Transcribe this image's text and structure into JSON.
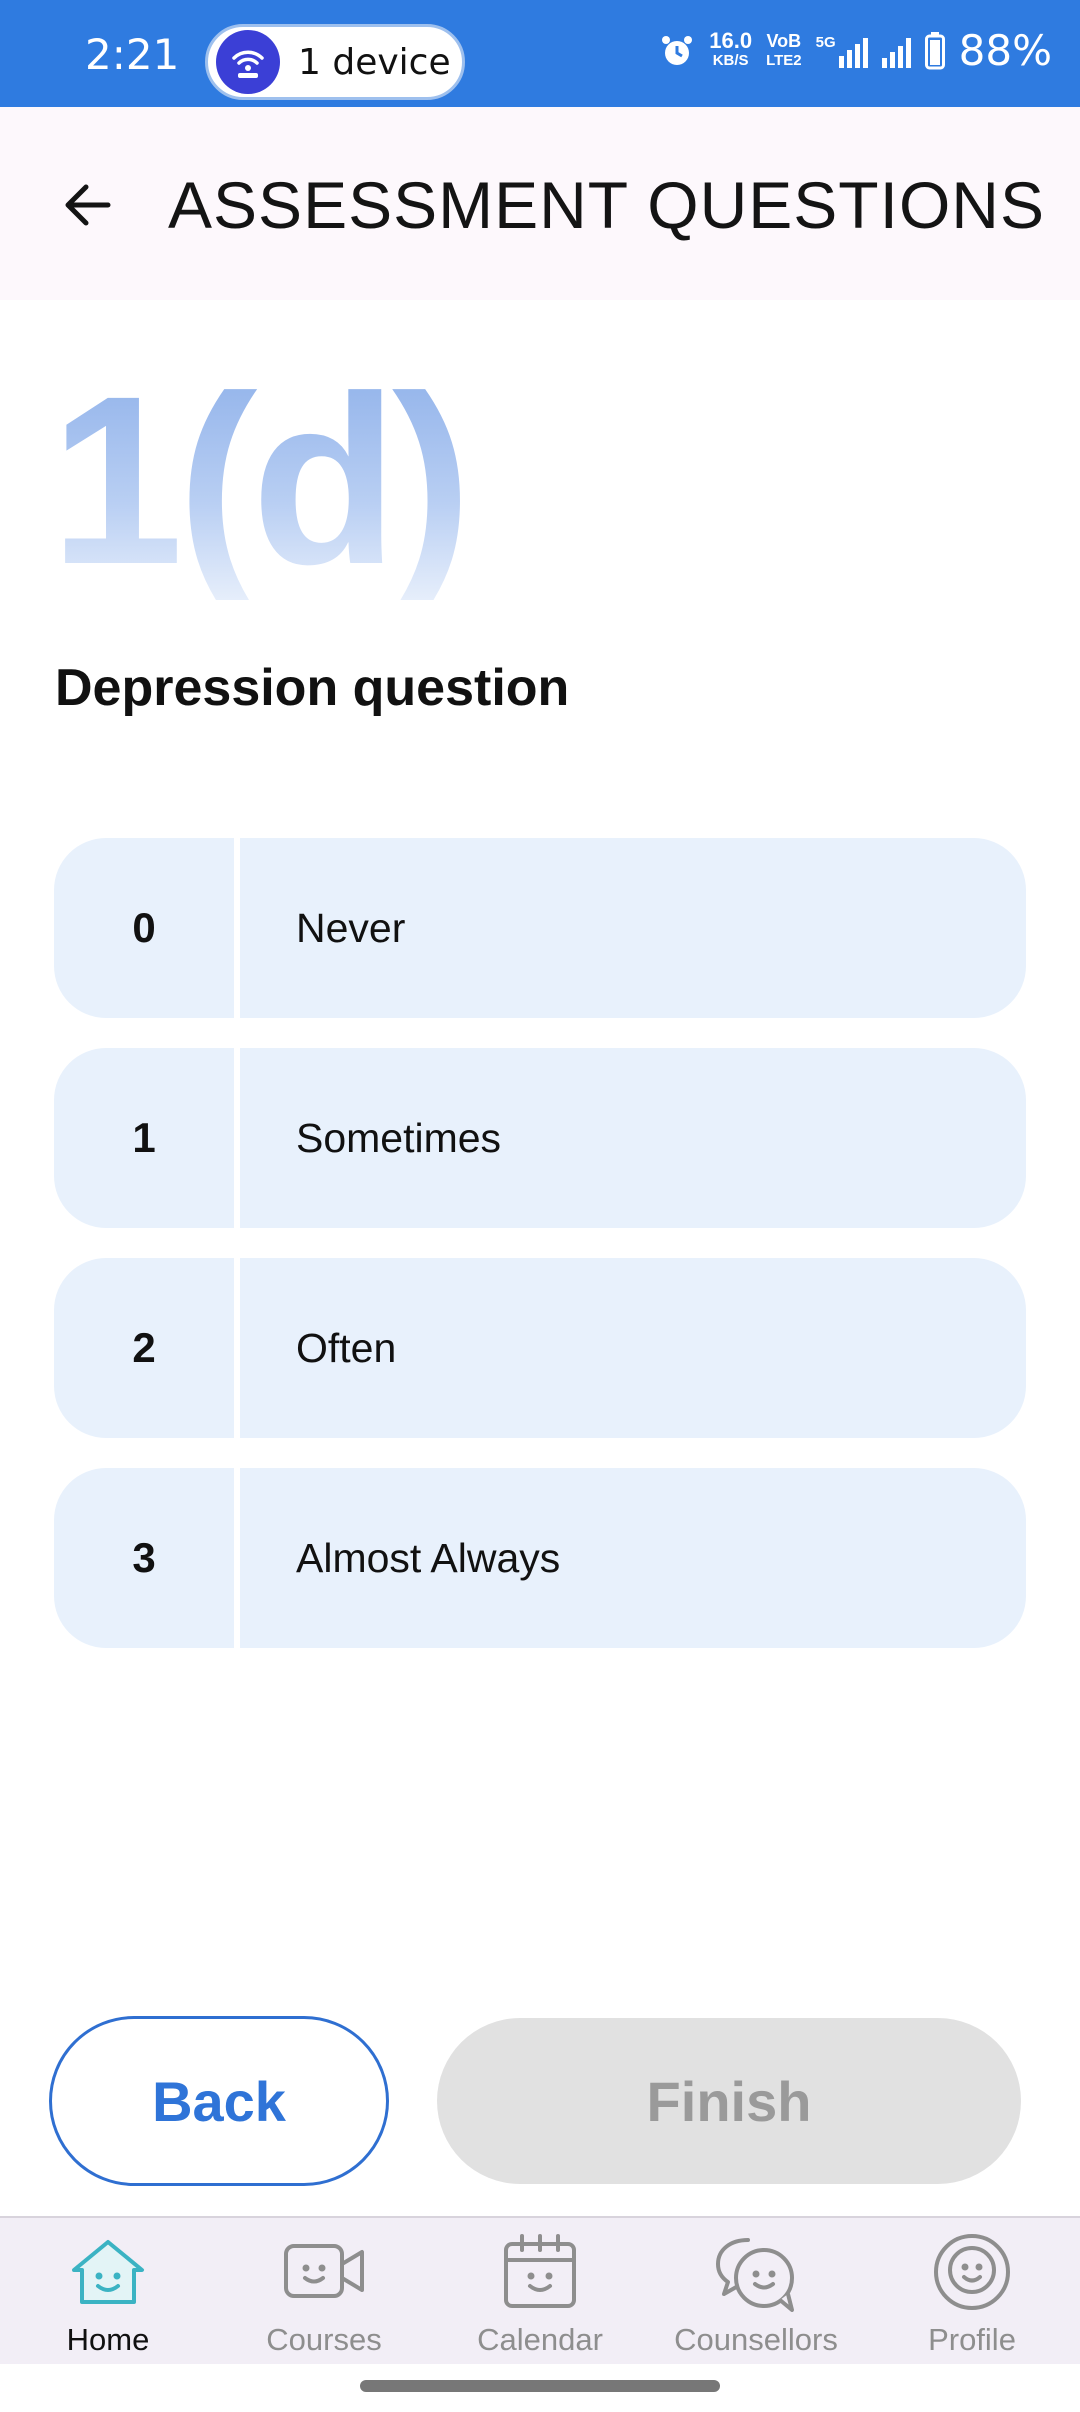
{
  "status_bar": {
    "time": "2:21",
    "hotspot_label": "1 device",
    "net_speed_value": "16.0",
    "net_speed_unit": "KB/S",
    "volte_top": "VoB",
    "volte_bottom": "LTE2",
    "network_type": "5G",
    "battery": "88%"
  },
  "header": {
    "title": "ASSESSMENT QUESTIONS"
  },
  "question": {
    "number": "1(d)",
    "title": "Depression question"
  },
  "options": [
    {
      "value": "0",
      "label": "Never"
    },
    {
      "value": "1",
      "label": "Sometimes"
    },
    {
      "value": "2",
      "label": "Often"
    },
    {
      "value": "3",
      "label": "Almost Always"
    }
  ],
  "actions": {
    "back_label": "Back",
    "finish_label": "Finish"
  },
  "bottom_nav": [
    {
      "label": "Home",
      "icon": "home-icon",
      "active": true
    },
    {
      "label": "Courses",
      "icon": "video-camera-icon",
      "active": false
    },
    {
      "label": "Calendar",
      "icon": "calendar-icon",
      "active": false
    },
    {
      "label": "Counsellors",
      "icon": "chat-bubbles-icon",
      "active": false
    },
    {
      "label": "Profile",
      "icon": "profile-icon",
      "active": false
    }
  ],
  "colors": {
    "status_bar": "#2f7be0",
    "accent": "#2f74d8",
    "option_bg": "#e8f1fc",
    "finish_disabled_bg": "#e1e1e1",
    "home_icon": "#3bb3c3"
  }
}
